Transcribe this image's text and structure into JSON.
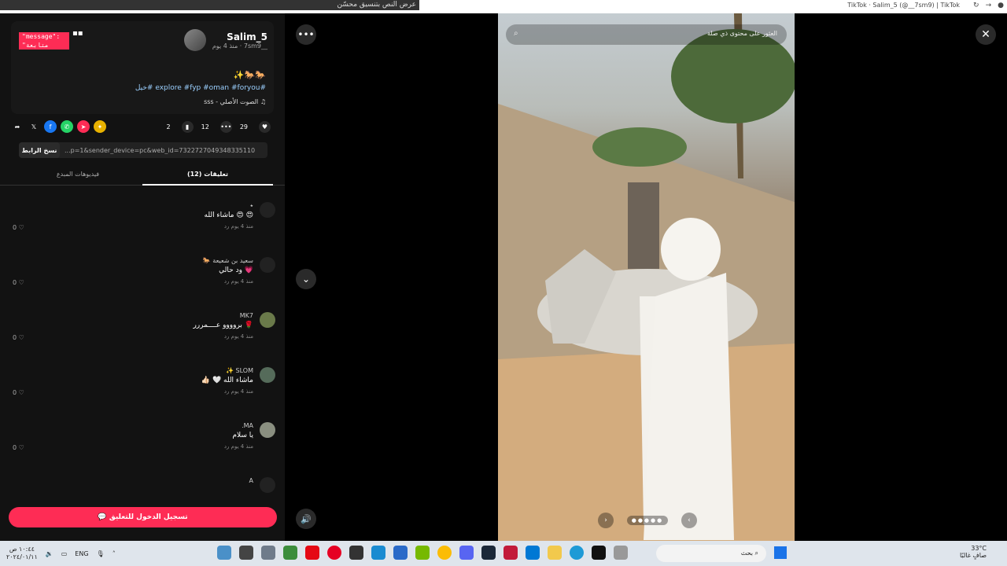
{
  "browser": {
    "devtools_text": "عرض النص بتنسيق محسّن",
    "title": "TikTok · Salim_5 (@__7sm9) | TikTok"
  },
  "post": {
    "author_name": "Salim_5",
    "author_sub": "__7sm9 · منذ 4 يوم",
    "follow_label": "\"message\": \"متابعة",
    "emojis": "🐎🐎✨",
    "tags": "#explore #fyp #oman #foryou #خيل",
    "sound": "♫ الصوت الأصلي - sss"
  },
  "actions": {
    "likes": "29",
    "comments": "12",
    "saves": "2"
  },
  "share": {
    "link": "...p=1&sender_device=pc&web_id=7322727049348335110",
    "copy_label": "نسخ الرابط"
  },
  "tabs": {
    "comments_label": "تعليقات (12)",
    "creator_videos_label": "فيديوهات المبدع"
  },
  "comments": [
    {
      "name": "٭",
      "text": "😍 😍 ماشاء الله",
      "meta": "منذ 4 يوم   رد",
      "likes": "0"
    },
    {
      "name": "سعيد بن شعيعة 🐎",
      "text": "💗 ود حالي",
      "meta": "منذ 4 يوم   رد",
      "likes": "0"
    },
    {
      "name": "MK7",
      "text": "🌹 بروووو عــــمررر",
      "meta": "منذ 4 يوم   رد",
      "likes": "0"
    },
    {
      "name": "SLOM ✨",
      "text": "ماشاء الله 🤍 👍🏻",
      "meta": "منذ 4 يوم   رد",
      "likes": "0"
    },
    {
      "name": "MA.",
      "text": "يا سلام",
      "meta": "منذ 4 يوم   رد",
      "likes": "0"
    },
    {
      "name": "A",
      "text": "",
      "meta": "",
      "likes": ""
    }
  ],
  "login_label": "💬 تسجيل الدخول للتعليق",
  "video": {
    "search_placeholder": "العثور على محتوى ذي صلة"
  },
  "taskbar": {
    "time": "١٠:٤٤ ص",
    "date": "٢٠٢٤/٠١/١١",
    "lang": "ENG",
    "search_label": "بحث",
    "temp": "33°C",
    "weather": "صافٍ غالبًا"
  },
  "colors": {
    "accent": "#fe2c55",
    "panel": "#121212"
  }
}
